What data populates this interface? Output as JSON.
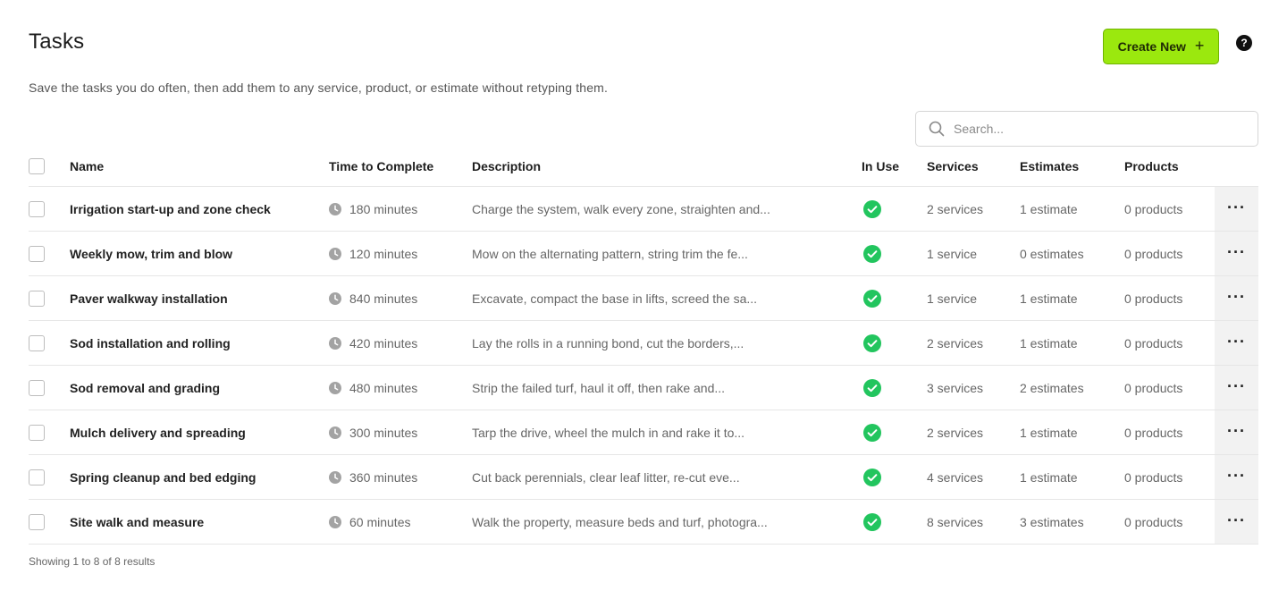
{
  "page": {
    "title": "Tasks",
    "subtitle": "Save the tasks you do often, then add them to any service, product, or estimate without retyping them.",
    "create_button": "Create New",
    "create_icon": "+",
    "help_icon": "?"
  },
  "search": {
    "placeholder": "Search..."
  },
  "columns": {
    "name": "Name",
    "time": "Time to Complete",
    "description": "Description",
    "in_use": "In Use",
    "services": "Services",
    "estimates": "Estimates",
    "products": "Products"
  },
  "rows": [
    {
      "name": "Irrigation start-up and zone check",
      "time": "180 minutes",
      "description": "Charge the system, walk every zone, straighten and...",
      "in_use": true,
      "services": "2 services",
      "estimates": "1 estimate",
      "products": "0 products"
    },
    {
      "name": "Weekly mow, trim and blow",
      "time": "120 minutes",
      "description": "Mow on the alternating pattern, string trim the fe...",
      "in_use": true,
      "services": "1 service",
      "estimates": "0 estimates",
      "products": "0 products"
    },
    {
      "name": "Paver walkway installation",
      "time": "840 minutes",
      "description": "Excavate, compact the base in lifts, screed the sa...",
      "in_use": true,
      "services": "1 service",
      "estimates": "1 estimate",
      "products": "0 products"
    },
    {
      "name": "Sod installation and rolling",
      "time": "420 minutes",
      "description": "Lay the rolls in a running bond, cut the borders,...",
      "in_use": true,
      "services": "2 services",
      "estimates": "1 estimate",
      "products": "0 products"
    },
    {
      "name": "Sod removal and grading",
      "time": "480 minutes",
      "description": "Strip the failed turf, haul it off, then rake and...",
      "in_use": true,
      "services": "3 services",
      "estimates": "2 estimates",
      "products": "0 products"
    },
    {
      "name": "Mulch delivery and spreading",
      "time": "300 minutes",
      "description": "Tarp the drive, wheel the mulch in and rake it to...",
      "in_use": true,
      "services": "2 services",
      "estimates": "1 estimate",
      "products": "0 products"
    },
    {
      "name": "Spring cleanup and bed edging",
      "time": "360 minutes",
      "description": "Cut back perennials, clear leaf litter, re-cut eve...",
      "in_use": true,
      "services": "4 services",
      "estimates": "1 estimate",
      "products": "0 products"
    },
    {
      "name": "Site walk and measure",
      "time": "60 minutes",
      "description": "Walk the property, measure beds and turf, photogra...",
      "in_use": true,
      "services": "8 services",
      "estimates": "3 estimates",
      "products": "0 products"
    }
  ],
  "row_menu_icon": "···",
  "footer": {
    "results": "Showing 1 to 8 of 8 results"
  },
  "colors": {
    "accent": "#9be80e",
    "in_use": "#22c55e"
  }
}
